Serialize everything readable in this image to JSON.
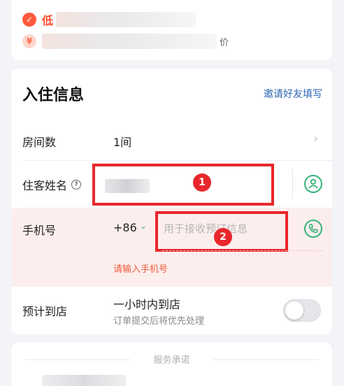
{
  "promo": {
    "badge1_icon": "thumbs-up-icon",
    "line1_text": "低",
    "line1_tail": "…该房型优惠",
    "badge2_icon": "coupon-icon",
    "line2_tail": "价"
  },
  "main": {
    "title": "入住信息",
    "invite_label": "邀请好友填写",
    "rooms": {
      "label": "房间数",
      "value": "1间"
    },
    "guest": {
      "label": "住客姓名",
      "help_icon": "question-icon",
      "marker": "1"
    },
    "phone": {
      "label": "手机号",
      "country_code": "+86",
      "placeholder": "用于接收预订信息",
      "marker": "2",
      "error": "请输入手机号"
    },
    "arrival": {
      "label": "预计到店",
      "value": "一小时内到店",
      "sub": "订单提交后将优先处理",
      "toggle_on": false
    }
  },
  "service": {
    "title": "服务承诺"
  },
  "colors": {
    "accent_green": "#35b378",
    "error_red": "#ef5a3c",
    "annotation_red": "#e8272b",
    "link_blue": "#2c66b3"
  }
}
